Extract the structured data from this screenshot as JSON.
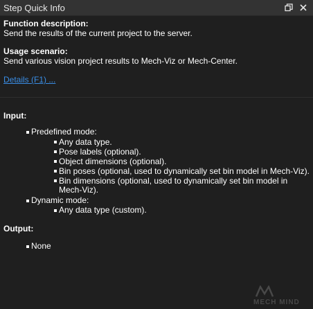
{
  "window": {
    "title": "Step Quick Info"
  },
  "controls": {
    "float_icon": "restore-window-icon",
    "close_icon": "close-icon"
  },
  "info": {
    "function_heading": "Function description:",
    "function_text": "Send the results of the current project to the server.",
    "usage_heading": "Usage scenario:",
    "usage_text": "Send various vision project results to Mech-Viz or Mech-Center.",
    "details_link": "Details (F1) ..."
  },
  "input": {
    "heading": "Input:",
    "predefined_label": "Predefined mode:",
    "predefined_items": [
      "Any data type.",
      "Pose labels (optional).",
      "Object dimensions (optional).",
      "Bin poses (optional, used to dynamically set bin model in Mech-Viz).",
      "Bin dimensions (optional, used to dynamically set bin model in",
      "Mech-Viz)."
    ],
    "dynamic_label": "Dynamic mode:",
    "dynamic_items": [
      "Any data type (custom)."
    ]
  },
  "output": {
    "heading": "Output:",
    "items": [
      "None"
    ]
  },
  "watermark": {
    "text": "MECH MIND"
  }
}
